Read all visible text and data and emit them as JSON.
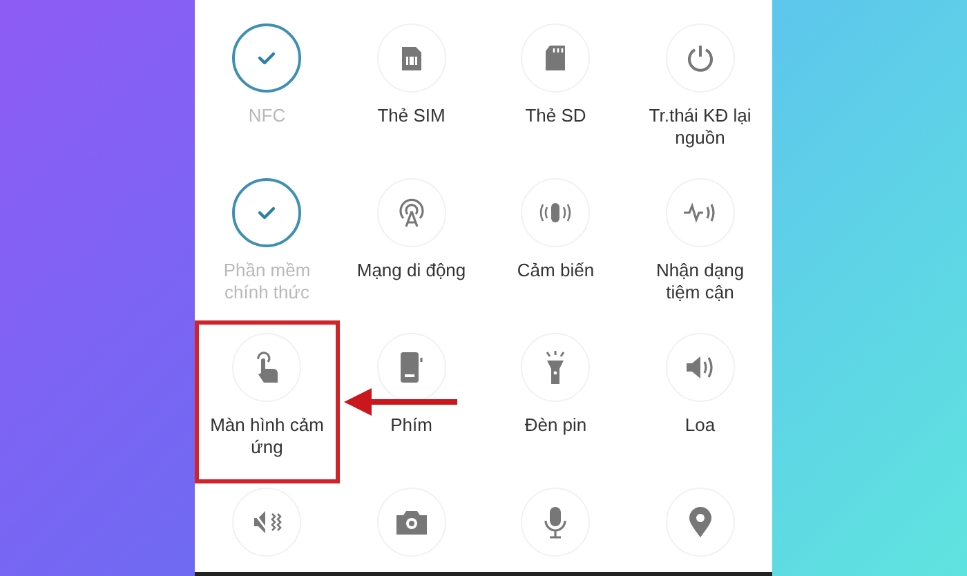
{
  "tests": [
    {
      "label": "NFC",
      "passed": true,
      "highlighted": false
    },
    {
      "label": "Thẻ SIM",
      "passed": false,
      "highlighted": false
    },
    {
      "label": "Thẻ SD",
      "passed": false,
      "highlighted": false
    },
    {
      "label": "Tr.thái KĐ lại nguồn",
      "passed": false,
      "highlighted": false
    },
    {
      "label": "Phần mềm chính thức",
      "passed": true,
      "highlighted": false
    },
    {
      "label": "Mạng di động",
      "passed": false,
      "highlighted": false
    },
    {
      "label": "Cảm biến",
      "passed": false,
      "highlighted": false
    },
    {
      "label": "Nhận dạng tiệm cận",
      "passed": false,
      "highlighted": false
    },
    {
      "label": "Màn hình cảm ứng",
      "passed": false,
      "highlighted": true
    },
    {
      "label": "Phím",
      "passed": false,
      "highlighted": false
    },
    {
      "label": "Đèn pin",
      "passed": false,
      "highlighted": false
    },
    {
      "label": "Loa",
      "passed": false,
      "highlighted": false
    },
    {
      "passed": false,
      "highlighted": false
    },
    {
      "passed": false,
      "highlighted": false
    },
    {
      "passed": false,
      "highlighted": false
    },
    {
      "passed": false,
      "highlighted": false
    }
  ]
}
